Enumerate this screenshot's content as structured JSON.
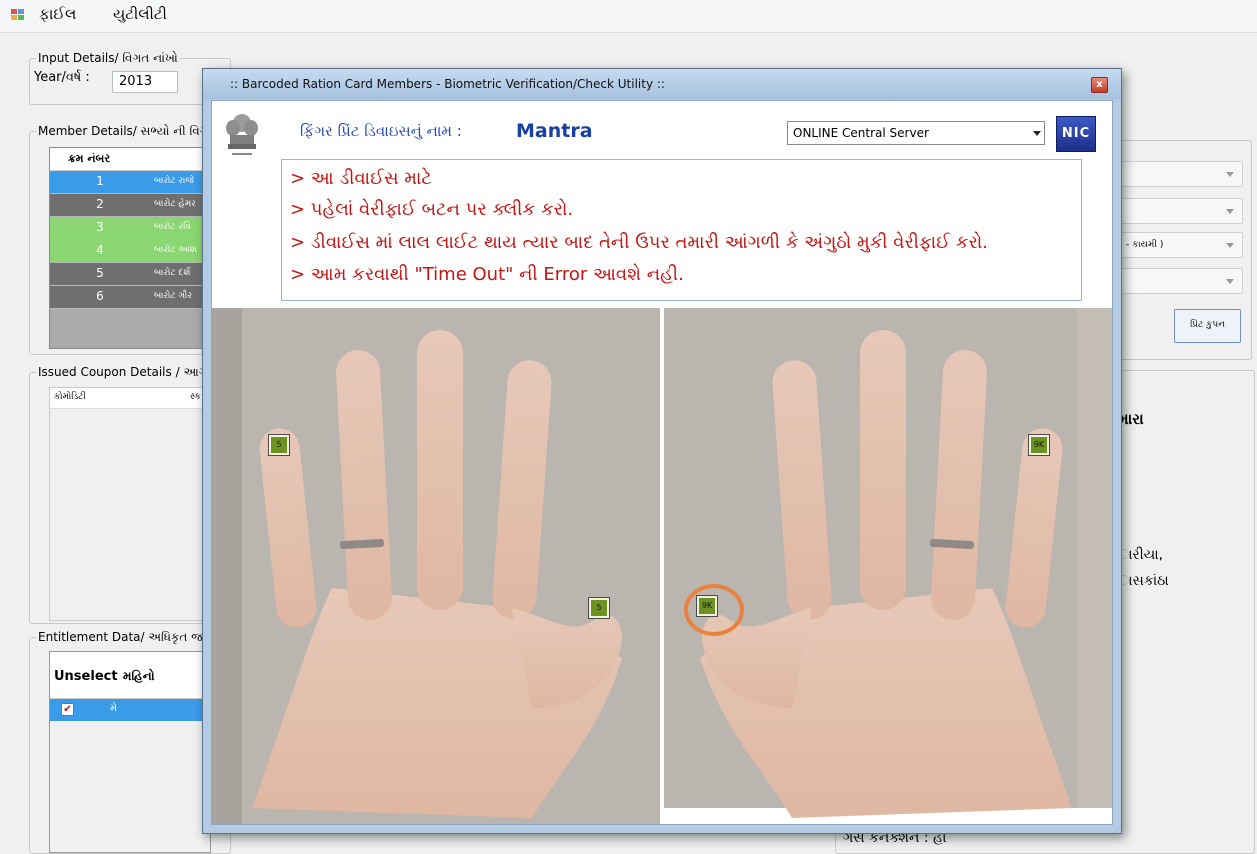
{
  "menu": {
    "items": [
      "ફાઈલ",
      "યુટીલીટી"
    ]
  },
  "input_details": {
    "group_title": "Input Details/ વિગત નાંખો",
    "year_label": "Year/વર્ષ :",
    "year_value": "2013"
  },
  "member_details": {
    "group_title": "Member Details/ સભ્યો ની વિગત",
    "column_header": "ક્રમ નંબર",
    "rows": [
      {
        "no": "1",
        "name": "બારોટ રાજે",
        "color": "#3a9ce8"
      },
      {
        "no": "2",
        "name": "બારોટ હેમર",
        "color": "#6f6f6f"
      },
      {
        "no": "3",
        "name": "બારોટ રવિ",
        "color": "#8ad672"
      },
      {
        "no": "4",
        "name": "બારોટ આશ",
        "color": "#8ad672"
      },
      {
        "no": "5",
        "name": "બારોટ દર્શ",
        "color": "#6f6f6f"
      },
      {
        "no": "6",
        "name": "બારોટ ગૌર",
        "color": "#6f6f6f"
      }
    ]
  },
  "issued_coupon": {
    "group_title": "Issued Coupon Details / આગા",
    "col1": "કોમોડિટી",
    "col2": "સ્ક"
  },
  "entitlement": {
    "group_title": "Entitlement Data/ અધિકૃત જથ્થા",
    "col1": "Unselect",
    "col2": "મહિનો",
    "row_month": "મે"
  },
  "right_panel": {
    "combo3_value": "- કાયમી )",
    "print_button": "પ્રિંટ કુપન",
    "heading_partial": "મારા",
    "address_line1": "ારીયા,",
    "address_line2": "ાસકાંઠા",
    "gas_connection": "ગેસ કનેક્શન : હા"
  },
  "dialog": {
    "title": ":: Barcoded Ration Card Members - Biometric Verification/Check Utility ::",
    "close_glyph": "x",
    "device_label": "ફિંગર પ્રિંટ ડિવાઇસનું નામ :",
    "device_name": "Mantra",
    "server_value": "ONLINE Central Server",
    "nic_logo": "NIC",
    "instructions": [
      "> આ ડીવાઈસ માટે",
      "> પહેલાં વેરીફાઈ બટન પર ક્લીક કરો.",
      "> ડીવાઈસ માં લાલ લાઈટ થાય ત્યાર બાદ તેની ઉપર તમારી આંગળી કે અંગુઠો મુકી વેરીફાઈ કરો.",
      "> આમ કરવાથી \"Time Out\" ની Error આવશે નહી."
    ],
    "finger_buttons": [
      "5",
      "5",
      "9K",
      "9K"
    ]
  },
  "colors": {
    "accent": "#3a9ce8",
    "instruction_text": "#c21515",
    "finger_button": "#6d9222",
    "highlight": "#e8823e"
  }
}
